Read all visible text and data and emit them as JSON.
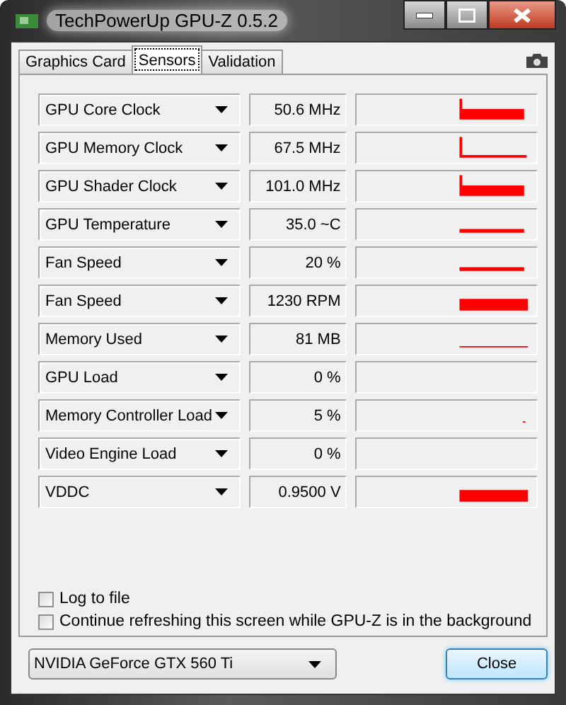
{
  "window": {
    "title": "TechPowerUp GPU-Z 0.5.2"
  },
  "tabs": [
    {
      "label": "Graphics Card",
      "selected": false
    },
    {
      "label": "Sensors",
      "selected": true
    },
    {
      "label": "Validation",
      "selected": false
    }
  ],
  "sensors": [
    {
      "name": "GPU Core Clock",
      "reading": "50.6 MHz",
      "kind": "spike"
    },
    {
      "name": "GPU Memory Clock",
      "reading": "67.5 MHz",
      "kind": "spike-thin"
    },
    {
      "name": "GPU Shader Clock",
      "reading": "101.0 MHz",
      "kind": "spike"
    },
    {
      "name": "GPU Temperature",
      "reading": "35.0 ~C",
      "kind": "low"
    },
    {
      "name": "Fan Speed",
      "reading": "20 %",
      "kind": "low"
    },
    {
      "name": "Fan Speed",
      "reading": "1230 RPM",
      "kind": "block"
    },
    {
      "name": "Memory Used",
      "reading": "81 MB",
      "kind": "line"
    },
    {
      "name": "GPU Load",
      "reading": "0 %",
      "kind": "empty"
    },
    {
      "name": "Memory Controller Load",
      "reading": "5 %",
      "kind": "tick"
    },
    {
      "name": "Video Engine Load",
      "reading": "0 %",
      "kind": "empty"
    },
    {
      "name": "VDDC",
      "reading": "0.9500 V",
      "kind": "block"
    }
  ],
  "options": [
    {
      "label": "Log to file",
      "checked": false
    },
    {
      "label": "Continue refreshing this screen while GPU-Z is in the background",
      "checked": false
    }
  ],
  "device": {
    "value": "NVIDIA GeForce GTX 560 Ti"
  },
  "buttons": [
    "Close"
  ]
}
